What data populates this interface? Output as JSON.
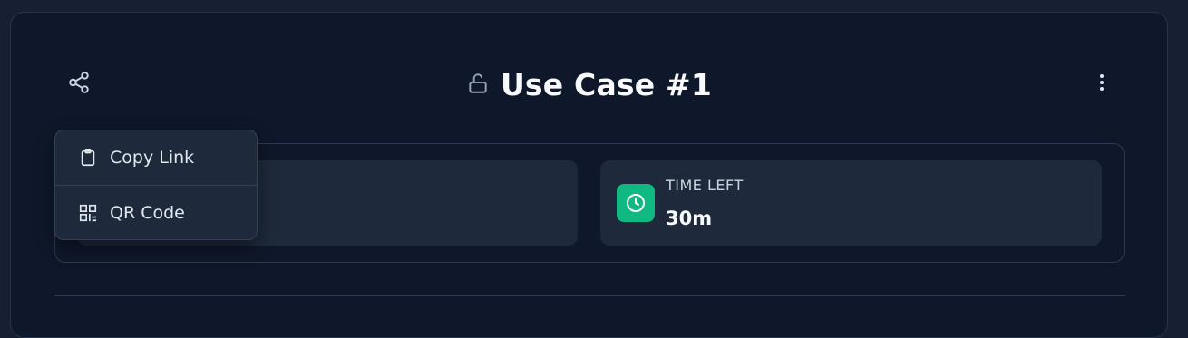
{
  "header": {
    "title": "Use Case #1",
    "share_icon": "share-icon",
    "lock_icon": "unlock-icon",
    "more_icon": "more-vertical-icon"
  },
  "stats": {
    "time_left": {
      "label": "TIME LEFT",
      "value": "30m",
      "icon": "clock-icon",
      "icon_bg": "#10b981"
    }
  },
  "share_menu": {
    "items": [
      {
        "label": "Copy Link",
        "icon": "clipboard-icon"
      },
      {
        "label": "QR Code",
        "icon": "qr-code-icon"
      }
    ]
  },
  "colors": {
    "background": "#0f172a",
    "card": "#1e293b",
    "accent": "#10b981"
  }
}
